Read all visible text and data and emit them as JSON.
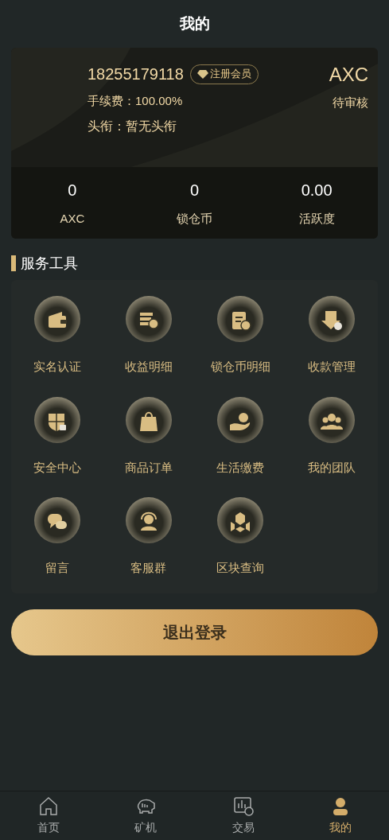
{
  "header": {
    "title": "我的"
  },
  "profile": {
    "phone": "18255179118",
    "badge": "注册会员",
    "fee": "手续费：100.00%",
    "title_line": "头衔：暂无头衔",
    "currency": "AXC",
    "status": "待审核"
  },
  "stats": [
    {
      "value": "0",
      "label": "AXC"
    },
    {
      "value": "0",
      "label": "锁仓币"
    },
    {
      "value": "0.00",
      "label": "活跃度"
    }
  ],
  "section": {
    "title": "服务工具"
  },
  "tools": [
    "实名认证",
    "收益明细",
    "锁仓币明细",
    "收款管理",
    "安全中心",
    "商品订单",
    "生活缴费",
    "我的团队",
    "留言",
    "客服群",
    "区块查询"
  ],
  "logout": "退出登录",
  "nav": [
    {
      "label": "首页",
      "selected": false
    },
    {
      "label": "矿机",
      "selected": false
    },
    {
      "label": "交易",
      "selected": false
    },
    {
      "label": "我的",
      "selected": true
    }
  ]
}
